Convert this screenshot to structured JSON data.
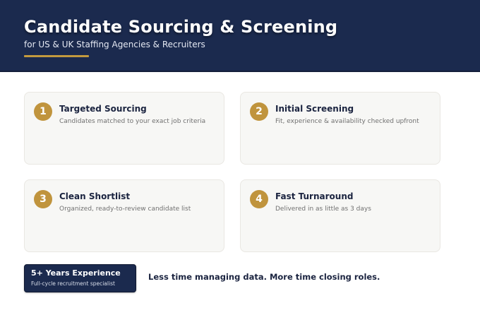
{
  "header": {
    "title": "Candidate Sourcing & Screening",
    "subtitle": "for US & UK Staffing Agencies & Recruiters",
    "accent_color": "#c39a3e",
    "background_color": "#1b2a4e"
  },
  "cards": [
    {
      "number": "1",
      "title": "Targeted Sourcing",
      "description": "Candidates matched to your exact job criteria"
    },
    {
      "number": "2",
      "title": "Initial Screening",
      "description": "Fit, experience & availability checked upfront"
    },
    {
      "number": "3",
      "title": "Clean Shortlist",
      "description": "Organized, ready-to-review candidate list"
    },
    {
      "number": "4",
      "title": "Fast Turnaround",
      "description": "Delivered in as little as 3 days"
    }
  ],
  "badge": {
    "title": "5+ Years Experience",
    "subtitle": "Full-cycle recruitment specialist"
  },
  "tagline": "Less time managing data. More time closing roles."
}
